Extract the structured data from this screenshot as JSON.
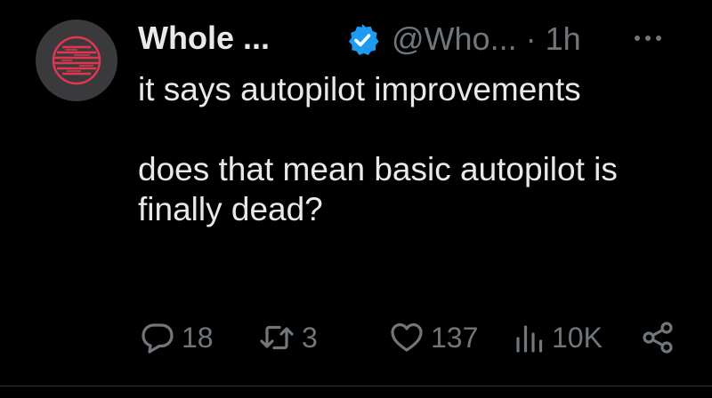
{
  "tweet": {
    "author_name": "Whole ...",
    "handle_and_time": "@Who... · 1h",
    "body_paragraphs": [
      "it says autopilot improvements",
      "does that mean basic autopilot is finally dead?"
    ],
    "reply_count": "18",
    "repost_count": "3",
    "like_count": "137",
    "view_count": "10K",
    "icons": {
      "avatar": "avatar-logo",
      "verified": "verified-badge-icon",
      "more": "more-icon",
      "reply": "reply-icon",
      "repost": "repost-icon",
      "like": "heart-icon",
      "views": "views-icon",
      "share": "share-icon"
    }
  },
  "colors": {
    "background": "#000000",
    "text_primary": "#e7e9ea",
    "text_secondary": "#71767b",
    "verified_blue": "#1d9bf0",
    "avatar_bg": "#3a3a3c",
    "avatar_accent": "#e0364f"
  }
}
